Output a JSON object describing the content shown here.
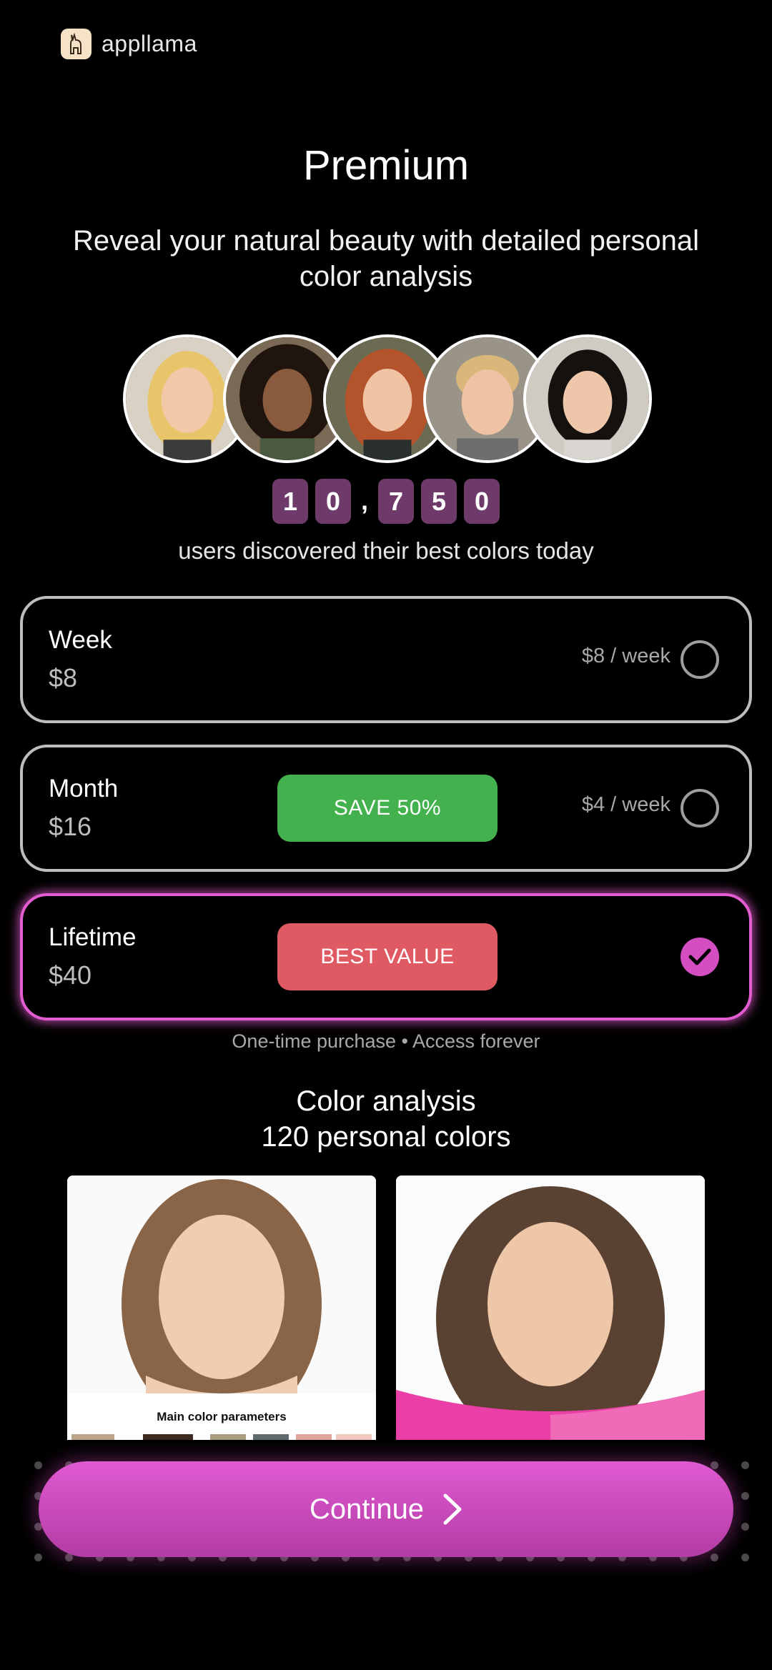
{
  "header": {
    "logo_text": "appllama",
    "logo_icon": "llama-icon"
  },
  "title": "Premium",
  "subtitle": "Reveal your natural beauty with detailed personal color analysis",
  "counter": {
    "digits": [
      "1",
      "0",
      "7",
      "5",
      "0"
    ],
    "separator": ",",
    "caption": "users discovered their best colors today"
  },
  "plans": [
    {
      "name": "Week",
      "price": "$8",
      "per_week": "$8 / week",
      "badge": "",
      "selected": false
    },
    {
      "name": "Month",
      "price": "$16",
      "per_week": "$4 / week",
      "badge": "SAVE 50%",
      "selected": false
    },
    {
      "name": "Lifetime",
      "price": "$40",
      "per_week": "",
      "badge": "BEST VALUE",
      "selected": true
    }
  ],
  "plan_note": "One-time purchase • Access forever",
  "section": {
    "line1": "Color analysis",
    "line2": "120 personal colors"
  },
  "preview": {
    "card1_caption": "Main color parameters"
  },
  "cta": {
    "label": "Continue",
    "icon": "chevron-right-icon"
  },
  "colors": {
    "accent": "#d44ec2",
    "green_badge": "#43b14d",
    "red_badge": "#e05a64",
    "digit_bg": "#6e3a6a"
  }
}
